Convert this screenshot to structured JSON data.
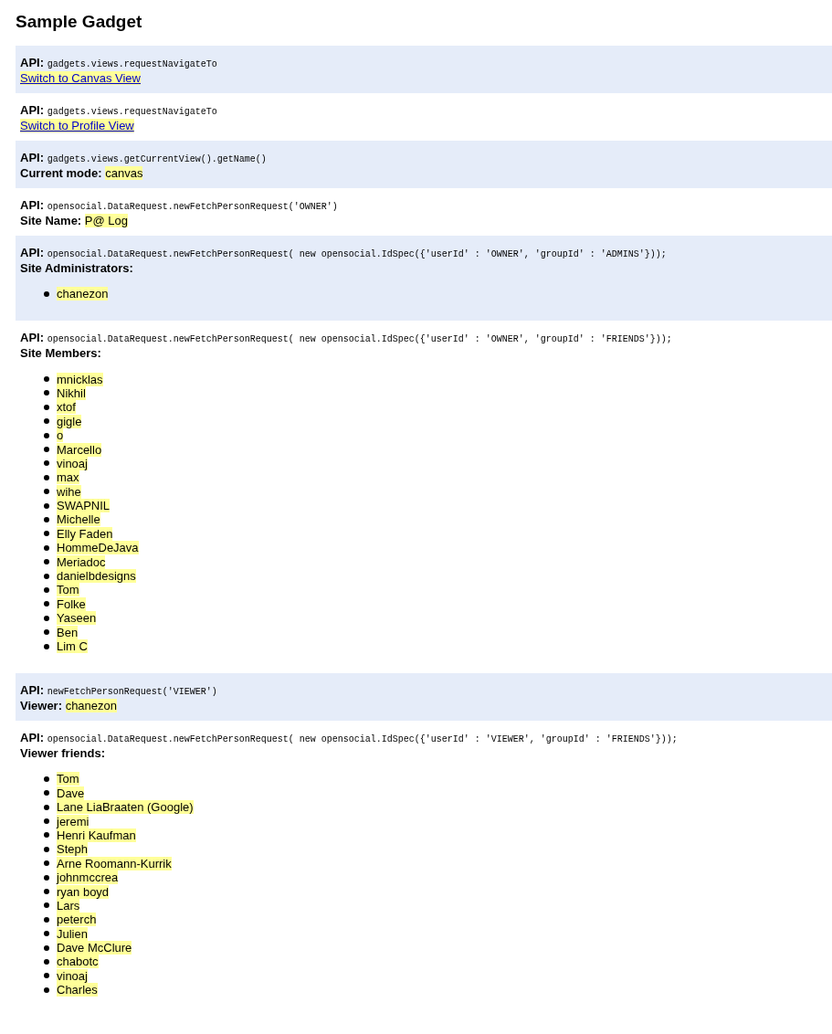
{
  "title": "Sample Gadget",
  "sections": [
    {
      "api_label": "API:",
      "api": "gadgets.views.requestNavigateTo",
      "kind": "link",
      "link": "Switch to Canvas View"
    },
    {
      "api_label": "API:",
      "api": "gadgets.views.requestNavigateTo",
      "kind": "link",
      "link": "Switch to Profile View"
    },
    {
      "api_label": "API:",
      "api": "gadgets.views.getCurrentView().getName()",
      "kind": "value",
      "label": "Current mode:",
      "value": "canvas"
    },
    {
      "api_label": "API:",
      "api": "opensocial.DataRequest.newFetchPersonRequest('OWNER')",
      "kind": "value",
      "label": "Site Name:",
      "value": "P@ Log"
    },
    {
      "api_label": "API:",
      "api": "opensocial.DataRequest.newFetchPersonRequest( new opensocial.IdSpec({'userId' : 'OWNER', 'groupId' : 'ADMINS'}));",
      "kind": "list",
      "label": "Site Administrators:",
      "items": [
        "chanezon"
      ]
    },
    {
      "api_label": "API:",
      "api": "opensocial.DataRequest.newFetchPersonRequest( new opensocial.IdSpec({'userId' : 'OWNER', 'groupId' : 'FRIENDS'}));",
      "kind": "list",
      "label": "Site Members:",
      "items": [
        "mnicklas",
        "Nikhil",
        "xtof",
        "gigle",
        "o",
        "Marcello",
        "vinoaj",
        "max",
        "wihe",
        "SWAPNIL",
        "Michelle",
        "Elly Faden",
        "HommeDeJava",
        "Meriadoc",
        "danielbdesigns",
        "Tom",
        "Folke",
        "Yaseen",
        "Ben",
        "Lim C"
      ]
    },
    {
      "api_label": "API:",
      "api": "newFetchPersonRequest('VIEWER')",
      "kind": "value",
      "label": "Viewer:",
      "value": "chanezon"
    },
    {
      "api_label": "API:",
      "api": "opensocial.DataRequest.newFetchPersonRequest( new opensocial.IdSpec({'userId' : 'VIEWER', 'groupId' : 'FRIENDS'}));",
      "kind": "list",
      "label": "Viewer friends:",
      "items": [
        "Tom",
        "Dave",
        "Lane LiaBraaten (Google)",
        "jeremi",
        "Henri Kaufman",
        "Steph",
        "Arne Roomann-Kurrik",
        "johnmccrea",
        "ryan boyd",
        "Lars",
        "peterch",
        "Julien",
        "Dave McClure",
        "chabotc",
        "vinoaj",
        "Charles"
      ]
    }
  ]
}
